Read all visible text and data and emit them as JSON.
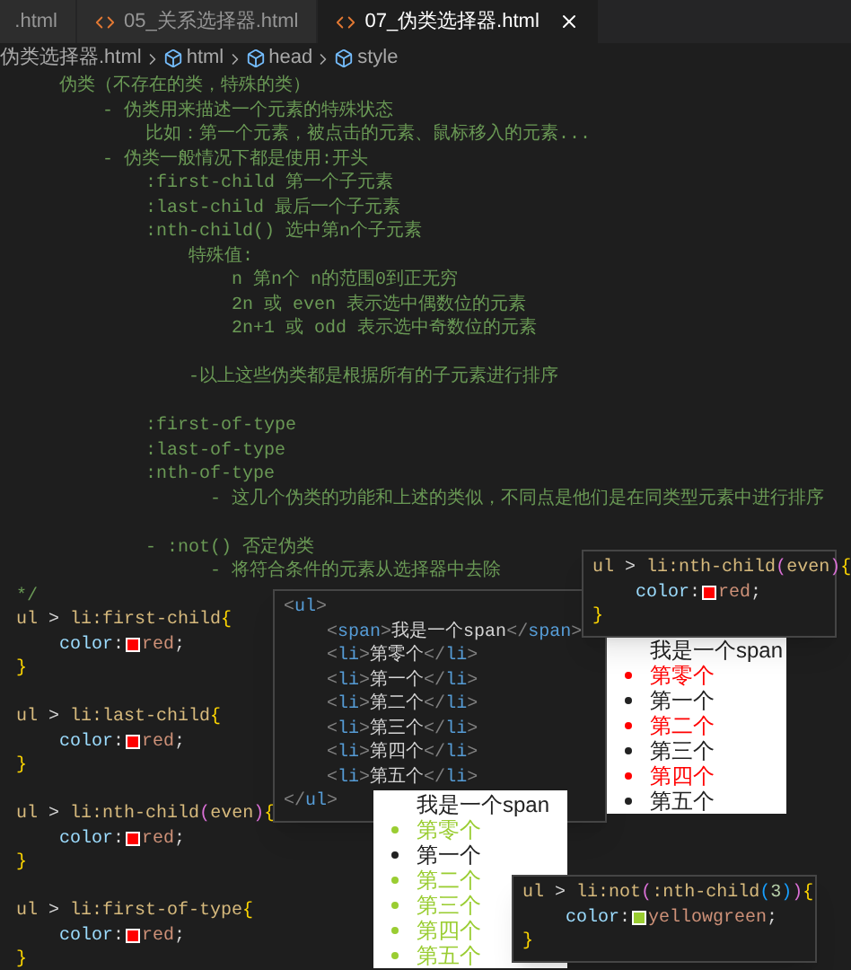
{
  "tabs": [
    {
      "label": ".html",
      "selected": false,
      "closable": false
    },
    {
      "label": "05_关系选择器.html",
      "selected": false,
      "closable": false
    },
    {
      "label": "07_伪类选择器.html",
      "selected": true,
      "closable": true
    }
  ],
  "breadcrumb": [
    {
      "label": "伪类选择器.html",
      "kind": "file"
    },
    {
      "label": "html",
      "kind": "symbol"
    },
    {
      "label": "head",
      "kind": "symbol"
    },
    {
      "label": "style",
      "kind": "symbol"
    }
  ],
  "code": [
    {
      "segments": [
        {
          "kind": "comment",
          "text": "    伪类（不存在的类，特殊的类）"
        }
      ]
    },
    {
      "segments": [
        {
          "kind": "comment",
          "text": "        - 伪类用来描述一个元素的特殊状态"
        }
      ]
    },
    {
      "segments": [
        {
          "kind": "comment",
          "text": "            比如：第一个元素，被点击的元素、鼠标移入的元素..."
        }
      ]
    },
    {
      "segments": [
        {
          "kind": "comment",
          "text": "        - 伪类一般情况下都是使用:开头"
        }
      ]
    },
    {
      "segments": [
        {
          "kind": "comment",
          "text": "            :first-child 第一个子元素"
        }
      ]
    },
    {
      "segments": [
        {
          "kind": "comment",
          "text": "            :last-child 最后一个子元素"
        }
      ]
    },
    {
      "segments": [
        {
          "kind": "comment",
          "text": "            :nth-child() 选中第n个子元素"
        }
      ]
    },
    {
      "segments": [
        {
          "kind": "comment",
          "text": "                特殊值:"
        }
      ]
    },
    {
      "segments": [
        {
          "kind": "comment",
          "text": "                    n 第n个 n的范围0到正无穷"
        }
      ]
    },
    {
      "segments": [
        {
          "kind": "comment",
          "text": "                    2n 或 even 表示选中偶数位的元素"
        }
      ]
    },
    {
      "segments": [
        {
          "kind": "comment",
          "text": "                    2n+1 或 odd 表示选中奇数位的元素"
        }
      ]
    },
    {
      "blank_before": true,
      "segments": [
        {
          "kind": "comment",
          "text": "                -以上这些伪类都是根据所有的子元素进行排序"
        }
      ]
    },
    {
      "blank_before": true,
      "segments": [
        {
          "kind": "comment",
          "text": "            :first-of-type"
        }
      ]
    },
    {
      "segments": [
        {
          "kind": "comment",
          "text": "            :last-of-type"
        }
      ]
    },
    {
      "segments": [
        {
          "kind": "comment",
          "text": "            :nth-of-type"
        }
      ]
    },
    {
      "segments": [
        {
          "kind": "comment",
          "text": "                  - 这几个伪类的功能和上述的类似，不同点是他们是在同类型元素中进行排序"
        }
      ]
    },
    {
      "blank_before": true,
      "segments": [
        {
          "kind": "comment",
          "text": "            - :not() 否定伪类"
        }
      ]
    },
    {
      "segments": [
        {
          "kind": "comment",
          "text": "                  - 将符合条件的元素从选择器中去除"
        }
      ]
    },
    {
      "segments": [
        {
          "kind": "comment",
          "text": "*/"
        }
      ]
    },
    {
      "segments": [
        {
          "kind": "sel",
          "text": "ul"
        },
        {
          "kind": "punct",
          "text": " > "
        },
        {
          "kind": "sel",
          "text": "li:first-child"
        },
        {
          "kind": "brace",
          "text": "{"
        }
      ]
    },
    {
      "segments": [
        {
          "kind": "prop",
          "text": "    color"
        },
        {
          "kind": "punct",
          "text": ":"
        },
        {
          "kind": "swatch",
          "color": "#ff0000"
        },
        {
          "kind": "val",
          "text": "red"
        },
        {
          "kind": "punct",
          "text": ";"
        }
      ]
    },
    {
      "segments": [
        {
          "kind": "brace",
          "text": "}"
        }
      ]
    },
    {
      "blank_before": true,
      "segments": [
        {
          "kind": "sel",
          "text": "ul"
        },
        {
          "kind": "punct",
          "text": " > "
        },
        {
          "kind": "sel",
          "text": "li:last-child"
        },
        {
          "kind": "brace",
          "text": "{"
        }
      ]
    },
    {
      "segments": [
        {
          "kind": "prop",
          "text": "    color"
        },
        {
          "kind": "punct",
          "text": ":"
        },
        {
          "kind": "swatch",
          "color": "#ff0000"
        },
        {
          "kind": "val",
          "text": "red"
        },
        {
          "kind": "punct",
          "text": ";"
        }
      ]
    },
    {
      "segments": [
        {
          "kind": "brace",
          "text": "}"
        }
      ]
    },
    {
      "blank_before": true,
      "segments": [
        {
          "kind": "sel",
          "text": "ul"
        },
        {
          "kind": "punct",
          "text": " > "
        },
        {
          "kind": "sel",
          "text": "li:nth-child"
        },
        {
          "kind": "brace2",
          "text": "("
        },
        {
          "kind": "sel",
          "text": "even"
        },
        {
          "kind": "brace2",
          "text": ")"
        },
        {
          "kind": "brace",
          "text": "{"
        }
      ]
    },
    {
      "segments": [
        {
          "kind": "prop",
          "text": "    color"
        },
        {
          "kind": "punct",
          "text": ":"
        },
        {
          "kind": "swatch",
          "color": "#ff0000"
        },
        {
          "kind": "val",
          "text": "red"
        },
        {
          "kind": "punct",
          "text": ";"
        }
      ]
    },
    {
      "segments": [
        {
          "kind": "brace",
          "text": "}"
        }
      ]
    },
    {
      "blank_before": true,
      "segments": [
        {
          "kind": "sel",
          "text": "ul"
        },
        {
          "kind": "punct",
          "text": " > "
        },
        {
          "kind": "sel",
          "text": "li:first-of-type"
        },
        {
          "kind": "brace",
          "text": "{"
        }
      ]
    },
    {
      "segments": [
        {
          "kind": "prop",
          "text": "    color"
        },
        {
          "kind": "punct",
          "text": ":"
        },
        {
          "kind": "swatch",
          "color": "#ff0000"
        },
        {
          "kind": "val",
          "text": "red"
        },
        {
          "kind": "punct",
          "text": ";"
        }
      ]
    },
    {
      "segments": [
        {
          "kind": "brace",
          "text": "}"
        }
      ]
    }
  ],
  "overlays": [
    {
      "kind": "code",
      "lines": [
        {
          "segments": [
            {
              "kind": "sel",
              "text": "ul"
            },
            {
              "kind": "punct",
              "text": " > "
            },
            {
              "kind": "sel",
              "text": "li:nth-child"
            },
            {
              "kind": "brace2",
              "text": "("
            },
            {
              "kind": "sel",
              "text": "even"
            },
            {
              "kind": "brace2",
              "text": ")"
            },
            {
              "kind": "brace",
              "text": "{"
            }
          ]
        },
        {
          "segments": [
            {
              "kind": "prop",
              "text": "    color"
            },
            {
              "kind": "punct",
              "text": ":"
            },
            {
              "kind": "swatch",
              "color": "#ff0000"
            },
            {
              "kind": "val",
              "text": "red"
            },
            {
              "kind": "punct",
              "text": ";"
            }
          ]
        },
        {
          "segments": [
            {
              "kind": "brace",
              "text": "}"
            }
          ]
        }
      ]
    },
    {
      "kind": "code",
      "lines": [
        {
          "segments": [
            {
              "kind": "tagp",
              "text": "<"
            },
            {
              "kind": "tag",
              "text": "ul"
            },
            {
              "kind": "tagp",
              "text": ">"
            }
          ]
        },
        {
          "segments": [
            {
              "kind": "tagp",
              "text": "    <"
            },
            {
              "kind": "tag",
              "text": "span"
            },
            {
              "kind": "tagp",
              "text": ">"
            },
            {
              "kind": "text",
              "text": "我是一个span"
            },
            {
              "kind": "tagp",
              "text": "</"
            },
            {
              "kind": "tag",
              "text": "span"
            },
            {
              "kind": "tagp",
              "text": ">"
            }
          ]
        },
        {
          "segments": [
            {
              "kind": "tagp",
              "text": "    <"
            },
            {
              "kind": "tag",
              "text": "li"
            },
            {
              "kind": "tagp",
              "text": ">"
            },
            {
              "kind": "text",
              "text": "第零个"
            },
            {
              "kind": "tagp",
              "text": "</"
            },
            {
              "kind": "tag",
              "text": "li"
            },
            {
              "kind": "tagp",
              "text": ">"
            }
          ]
        },
        {
          "segments": [
            {
              "kind": "tagp",
              "text": "    <"
            },
            {
              "kind": "tag",
              "text": "li"
            },
            {
              "kind": "tagp",
              "text": ">"
            },
            {
              "kind": "text",
              "text": "第一个"
            },
            {
              "kind": "tagp",
              "text": "</"
            },
            {
              "kind": "tag",
              "text": "li"
            },
            {
              "kind": "tagp",
              "text": ">"
            }
          ]
        },
        {
          "segments": [
            {
              "kind": "tagp",
              "text": "    <"
            },
            {
              "kind": "tag",
              "text": "li"
            },
            {
              "kind": "tagp",
              "text": ">"
            },
            {
              "kind": "text",
              "text": "第二个"
            },
            {
              "kind": "tagp",
              "text": "</"
            },
            {
              "kind": "tag",
              "text": "li"
            },
            {
              "kind": "tagp",
              "text": ">"
            }
          ]
        },
        {
          "segments": [
            {
              "kind": "tagp",
              "text": "    <"
            },
            {
              "kind": "tag",
              "text": "li"
            },
            {
              "kind": "tagp",
              "text": ">"
            },
            {
              "kind": "text",
              "text": "第三个"
            },
            {
              "kind": "tagp",
              "text": "</"
            },
            {
              "kind": "tag",
              "text": "li"
            },
            {
              "kind": "tagp",
              "text": ">"
            }
          ]
        },
        {
          "segments": [
            {
              "kind": "tagp",
              "text": "    <"
            },
            {
              "kind": "tag",
              "text": "li"
            },
            {
              "kind": "tagp",
              "text": ">"
            },
            {
              "kind": "text",
              "text": "第四个"
            },
            {
              "kind": "tagp",
              "text": "</"
            },
            {
              "kind": "tag",
              "text": "li"
            },
            {
              "kind": "tagp",
              "text": ">"
            }
          ]
        },
        {
          "segments": [
            {
              "kind": "tagp",
              "text": "    <"
            },
            {
              "kind": "tag",
              "text": "li"
            },
            {
              "kind": "tagp",
              "text": ">"
            },
            {
              "kind": "text",
              "text": "第五个"
            },
            {
              "kind": "tagp",
              "text": "</"
            },
            {
              "kind": "tag",
              "text": "li"
            },
            {
              "kind": "tagp",
              "text": ">"
            }
          ]
        },
        {
          "segments": [
            {
              "kind": "tagp",
              "text": "</"
            },
            {
              "kind": "tag",
              "text": "ul"
            },
            {
              "kind": "tagp",
              "text": ">"
            }
          ]
        }
      ]
    },
    {
      "kind": "result",
      "items": [
        {
          "kind": "span",
          "text": "我是一个span",
          "color": "#222222"
        },
        {
          "kind": "li",
          "text": "第零个",
          "color": "#ff0000"
        },
        {
          "kind": "li",
          "text": "第一个",
          "color": "#222222"
        },
        {
          "kind": "li",
          "text": "第二个",
          "color": "#ff0000"
        },
        {
          "kind": "li",
          "text": "第三个",
          "color": "#222222"
        },
        {
          "kind": "li",
          "text": "第四个",
          "color": "#ff0000"
        },
        {
          "kind": "li",
          "text": "第五个",
          "color": "#222222"
        }
      ]
    },
    {
      "kind": "result",
      "items": [
        {
          "kind": "span",
          "text": "我是一个span",
          "color": "#222222"
        },
        {
          "kind": "li",
          "text": "第零个",
          "color": "#9acd32"
        },
        {
          "kind": "li",
          "text": "第一个",
          "color": "#222222"
        },
        {
          "kind": "li",
          "text": "第二个",
          "color": "#9acd32"
        },
        {
          "kind": "li",
          "text": "第三个",
          "color": "#9acd32"
        },
        {
          "kind": "li",
          "text": "第四个",
          "color": "#9acd32"
        },
        {
          "kind": "li",
          "text": "第五个",
          "color": "#9acd32"
        }
      ]
    },
    {
      "kind": "code",
      "lines": [
        {
          "segments": [
            {
              "kind": "sel",
              "text": "ul"
            },
            {
              "kind": "punct",
              "text": " > "
            },
            {
              "kind": "sel",
              "text": "li:not"
            },
            {
              "kind": "brace2",
              "text": "("
            },
            {
              "kind": "sel",
              "text": ":nth-child"
            },
            {
              "kind": "brace3",
              "text": "("
            },
            {
              "kind": "num",
              "text": "3"
            },
            {
              "kind": "brace3",
              "text": ")"
            },
            {
              "kind": "brace2",
              "text": ")"
            },
            {
              "kind": "brace",
              "text": "{"
            }
          ]
        },
        {
          "segments": [
            {
              "kind": "prop",
              "text": "    color"
            },
            {
              "kind": "punct",
              "text": ":"
            },
            {
              "kind": "swatch",
              "color": "#9acd32"
            },
            {
              "kind": "val",
              "text": "yellowgreen"
            },
            {
              "kind": "punct",
              "text": ";"
            }
          ]
        },
        {
          "segments": [
            {
              "kind": "brace",
              "text": "}"
            }
          ]
        }
      ]
    }
  ]
}
